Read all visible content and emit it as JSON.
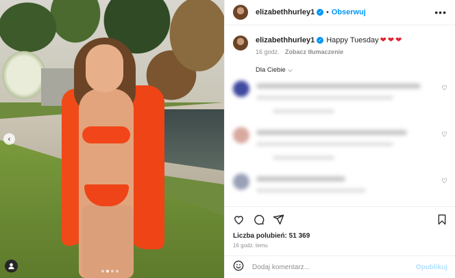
{
  "post": {
    "username": "elizabethhurley1",
    "follow_label": "Obserwuj",
    "separator": "•",
    "more_label": "•••",
    "caption_text": "Happy Tuesday",
    "caption_hearts": [
      "❤",
      "❤",
      "❤"
    ],
    "caption_age": "16 godz.",
    "translate_label": "Zobacz tłumaczenie",
    "filter_label": "Dla Ciebie",
    "likes_text": "Liczba polubień: 51 369",
    "time_text": "16 godz. temu",
    "comment_placeholder": "Dodaj komentarz...",
    "publish_label": "Opublikuj",
    "carousel": {
      "slides": 4,
      "active": 1
    }
  },
  "icons": {
    "prev": "chevron-left-icon",
    "tagged_user": "user-tag-icon",
    "verified": "verified-badge-icon",
    "more": "more-options-icon",
    "like": "heart-outline-icon",
    "comment": "comment-bubble-icon",
    "share": "paper-plane-icon",
    "save": "bookmark-icon",
    "emoji": "smiley-icon",
    "comment_like": "small-heart-icon"
  },
  "colors": {
    "accent": "#0095f6",
    "publish_disabled": "#b2dffc",
    "heart_red": "#e0212d",
    "muted": "#8e8e8e"
  }
}
